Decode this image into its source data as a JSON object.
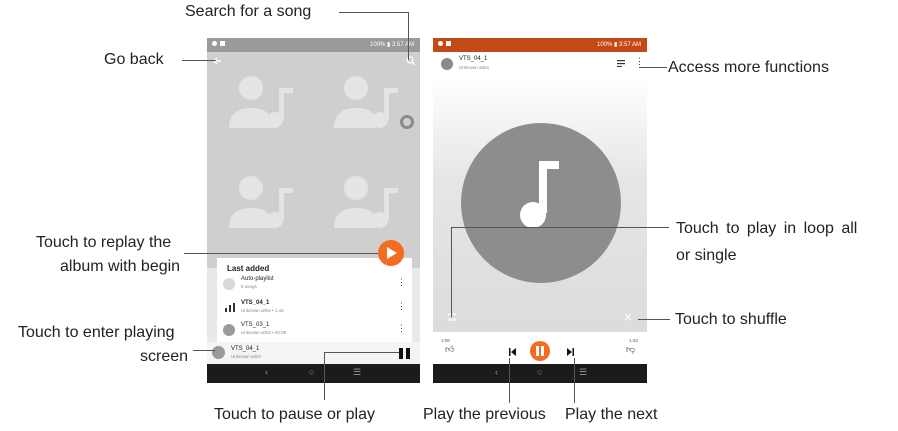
{
  "callouts": {
    "go_back": "Go back",
    "search_song": "Search for a song",
    "replay_album_1": "Touch to replay the",
    "replay_album_2": "album with begin",
    "enter_playing_1": "Touch to enter  playing",
    "enter_playing_2": "screen",
    "pause_play": "Touch to pause or play",
    "more_functions": "Access more functions",
    "loop_1": "Touch to play in loop all",
    "loop_2": "or single",
    "shuffle": "Touch to shuffle",
    "play_previous": "Play the previous",
    "play_next": "Play the next"
  },
  "phone1": {
    "status": "100% ▮ 3:57 AM",
    "section_title": "Last added",
    "playlist": {
      "title": "Auto-playlist",
      "subtitle": "8 songs"
    },
    "tracks": [
      {
        "title": "VTS_04_1",
        "subtitle": "Unknown artist • 1:43"
      },
      {
        "title": "VTS_03_1",
        "subtitle": "Unknown artist • 20:09"
      }
    ],
    "mini_player": {
      "title": "VTS_04_1",
      "subtitle": "Unknown artist"
    },
    "nav": {
      "back": "‹",
      "home": "○",
      "recent": "☰"
    }
  },
  "phone2": {
    "status": "100% ▮ 3:57 AM",
    "track": {
      "title": "VTS_04_1",
      "subtitle": "Unknown artist"
    },
    "elapsed": "1:06",
    "duration": "1:43",
    "progress": 0.64,
    "nav": {
      "back": "‹",
      "home": "○",
      "recent": "☰"
    }
  },
  "colors": {
    "accent": "#f36c21",
    "status_bar_2": "#c44a15",
    "art_gray": "#cfcfcf"
  }
}
